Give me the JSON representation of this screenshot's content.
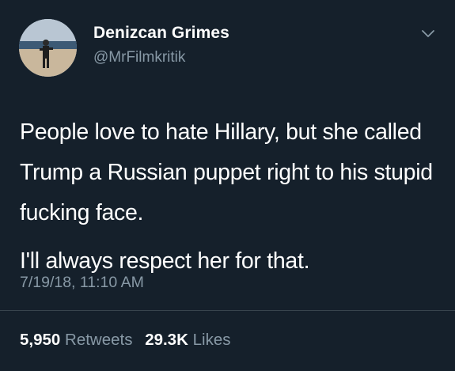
{
  "author": {
    "name": "Denizcan Grimes",
    "handle": "@MrFilmkritik"
  },
  "tweet": {
    "paragraphs": [
      "People love to hate Hillary, but she called Trump a Russian puppet right to his stupid fucking face.",
      "I'll always respect her for that."
    ],
    "timestamp": "7/19/18, 11:10 AM"
  },
  "stats": {
    "retweets_count": "5,950",
    "retweets_label": "Retweets",
    "likes_count": "29.3K",
    "likes_label": "Likes"
  },
  "icons": {
    "menu": "chevron-down-icon"
  },
  "colors": {
    "background": "#15202b",
    "primary_text": "#ffffff",
    "secondary_text": "#8899a6",
    "divider": "#38444d"
  }
}
